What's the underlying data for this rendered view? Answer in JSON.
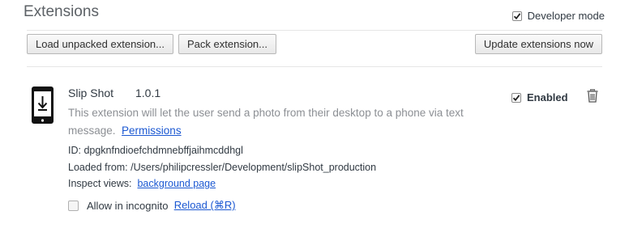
{
  "header": {
    "title": "Extensions",
    "developer_mode": {
      "label": "Developer mode",
      "checked": true
    }
  },
  "toolbar": {
    "load_unpacked": "Load unpacked extension...",
    "pack": "Pack extension...",
    "update": "Update extensions now"
  },
  "extension": {
    "icon": "phone-download-icon",
    "name": "Slip Shot",
    "version": "1.0.1",
    "description": "This extension will let the user send a photo from their desktop to a phone via text message.",
    "permissions_link": "Permissions",
    "id_line": "ID: dpgknfndioefchdmnebffjaihmcddhgl",
    "loaded_from_label": "Loaded from:",
    "loaded_from_path": "/Users/philipcressler/Development/slipShot_production",
    "inspect_label": "Inspect views:",
    "inspect_link": "background page",
    "enabled": {
      "label": "Enabled",
      "checked": true
    },
    "trash_icon": "trash-icon",
    "incognito": {
      "label": "Allow in incognito",
      "checked": false
    },
    "reload_link": "Reload (⌘R)"
  }
}
